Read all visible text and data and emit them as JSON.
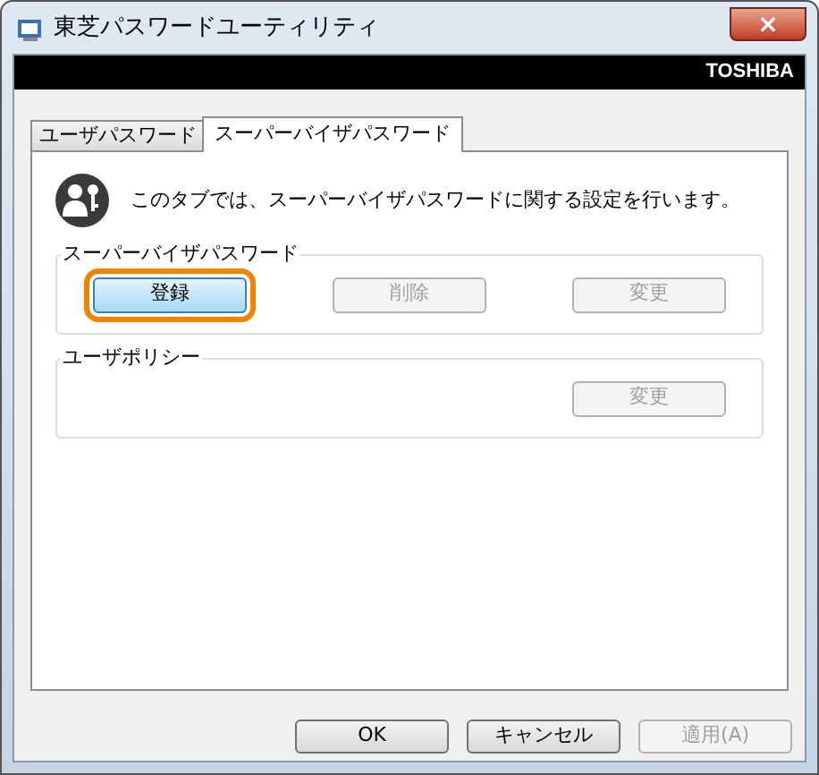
{
  "window": {
    "title": "東芝パスワードユーティリティ",
    "close": "×"
  },
  "banner": {
    "brand": "TOSHIBA"
  },
  "tabs": [
    {
      "label": "ユーザパスワード",
      "selected": false
    },
    {
      "label": "スーパーバイザパスワード",
      "selected": true
    }
  ],
  "description": "このタブでは、スーパーバイザパスワードに関する設定を行います。",
  "groups": [
    {
      "legend": "スーパーバイザパスワード",
      "buttons": [
        {
          "label": "登録",
          "disabled": false,
          "highlighted": true
        },
        {
          "label": "削除",
          "disabled": true,
          "highlighted": false
        },
        {
          "label": "変更",
          "disabled": true,
          "highlighted": false
        }
      ]
    },
    {
      "legend": "ユーザポリシー",
      "buttons": [
        {
          "label": "変更",
          "disabled": true,
          "highlighted": false
        }
      ]
    }
  ],
  "footer_buttons": [
    {
      "label": "OK",
      "disabled": false
    },
    {
      "label": "キャンセル",
      "disabled": false
    },
    {
      "label": "適用(A)",
      "disabled": true
    }
  ]
}
